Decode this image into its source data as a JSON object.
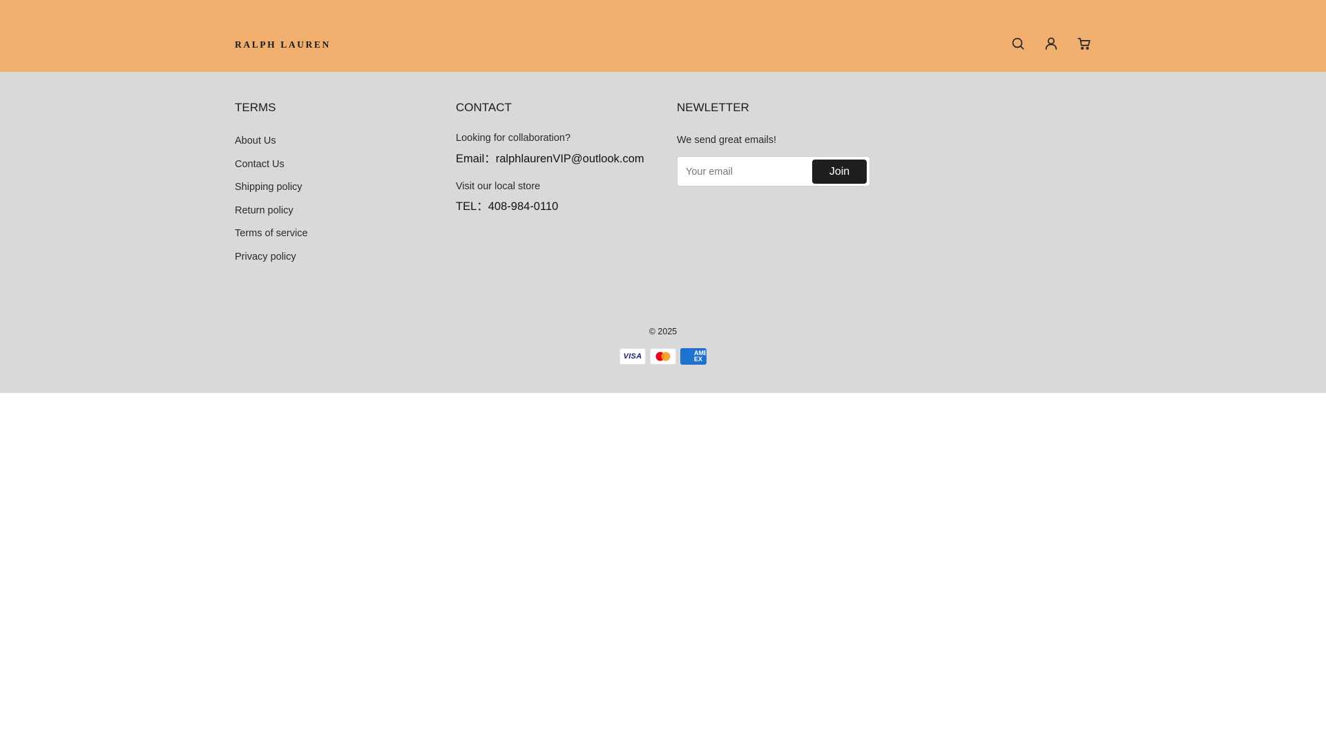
{
  "header": {
    "logo": "RALPH LAUREN",
    "icons": [
      "search-icon",
      "account-icon",
      "cart-icon"
    ]
  },
  "footer": {
    "terms": {
      "title": "TERMS",
      "links": [
        "About Us",
        "Contact Us",
        "Shipping policy",
        "Return policy",
        "Terms of service",
        "Privacy policy"
      ]
    },
    "contact": {
      "title": "CONTACT",
      "collab_label": "Looking for collaboration?",
      "email_text": "Email：ralphlaurenVIP@outlook.com",
      "store_label": "Visit our local store",
      "tel_text": "TEL：408-984-0110"
    },
    "newsletter": {
      "title": "NEWLETTER",
      "text": "We send great emails!",
      "placeholder": "Your email",
      "button": "Join"
    },
    "copyright": "© 2025",
    "payments": {
      "visa": "VISA",
      "mastercard": "mastercard",
      "amex": "AMERICAN EXPRESS"
    }
  },
  "colors": {
    "header_bg": "#f0ae6f",
    "footer_bg": "#d9d9d9",
    "button_bg": "#1f1f1f",
    "mastercard_red": "#eb001b",
    "mastercard_orange": "#f79e1b",
    "amex_blue": "#1f72cd"
  }
}
